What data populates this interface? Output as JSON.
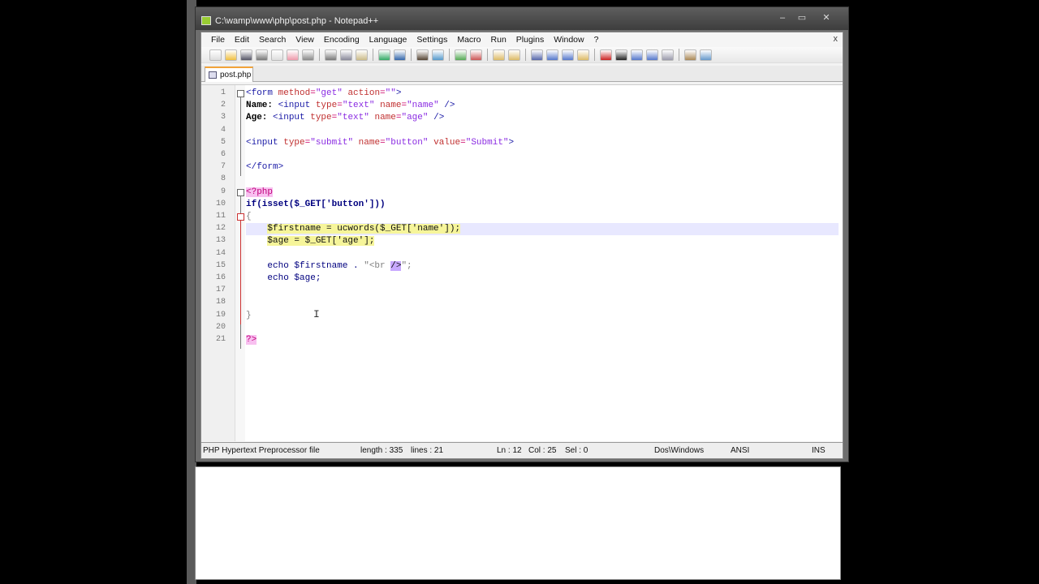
{
  "window": {
    "title": "C:\\wamp\\www\\php\\post.php - Notepad++",
    "minimize": "–",
    "maximize": "▭",
    "close": "✕"
  },
  "menu": [
    "File",
    "Edit",
    "Search",
    "View",
    "Encoding",
    "Language",
    "Settings",
    "Macro",
    "Run",
    "Plugins",
    "Window",
    "?"
  ],
  "menu_close": "x",
  "toolbar": [
    "new-file",
    "open-file",
    "save",
    "save-all",
    "close",
    "close-all",
    "print",
    "|",
    "cut",
    "copy",
    "paste",
    "|",
    "undo",
    "redo",
    "|",
    "find",
    "replace",
    "|",
    "zoom-in",
    "zoom-out",
    "|",
    "sync-v",
    "sync-h",
    "|",
    "word-wrap",
    "show-all-chars",
    "indent-guide",
    "user-lang",
    "|",
    "record-macro",
    "stop-record",
    "play-macro",
    "run-macro-multiple",
    "save-macro",
    "|",
    "launch-browser",
    "spell-check"
  ],
  "tab": {
    "label": "post.php"
  },
  "code": [
    [
      [
        "<form ",
        "tag"
      ],
      [
        "method",
        "attr"
      ],
      [
        "=",
        "op"
      ],
      [
        "\"get\" ",
        "str"
      ],
      [
        "action",
        "attr"
      ],
      [
        "=",
        "op"
      ],
      [
        "\"\"",
        "str"
      ],
      [
        ">",
        "tag"
      ]
    ],
    [
      [
        "Name: ",
        "plain"
      ],
      [
        "<input ",
        "tag"
      ],
      [
        "type",
        "attr"
      ],
      [
        "=",
        "op"
      ],
      [
        "\"text\" ",
        "str"
      ],
      [
        "name",
        "attr"
      ],
      [
        "=",
        "op"
      ],
      [
        "\"name\" ",
        "str"
      ],
      [
        "/>",
        "tag"
      ]
    ],
    [
      [
        "Age: ",
        "plain"
      ],
      [
        "<input ",
        "tag"
      ],
      [
        "type",
        "attr"
      ],
      [
        "=",
        "op"
      ],
      [
        "\"text\" ",
        "str"
      ],
      [
        "name",
        "attr"
      ],
      [
        "=",
        "op"
      ],
      [
        "\"age\" ",
        "str"
      ],
      [
        "/>",
        "tag"
      ]
    ],
    [],
    [
      [
        "<input ",
        "tag"
      ],
      [
        "type",
        "attr"
      ],
      [
        "=",
        "op"
      ],
      [
        "\"submit\" ",
        "str"
      ],
      [
        "name",
        "attr"
      ],
      [
        "=",
        "op"
      ],
      [
        "\"button\" ",
        "str"
      ],
      [
        "value",
        "attr"
      ],
      [
        "=",
        "op"
      ],
      [
        "\"Submit\"",
        "str"
      ],
      [
        ">",
        "tag"
      ]
    ],
    [],
    [
      [
        "</form>",
        "tag"
      ]
    ],
    [],
    [
      [
        "<?php",
        "php"
      ]
    ],
    [
      [
        "if(isset($_GET['button']))",
        "kw"
      ]
    ],
    [
      [
        "{",
        "phpstr"
      ]
    ],
    [
      [
        "    ",
        "plain"
      ],
      [
        "$firstname = ucwords($_GET['name']);",
        "hl"
      ]
    ],
    [
      [
        "    ",
        "plain"
      ],
      [
        "$age = $_GET['age'];",
        "hl"
      ]
    ],
    [],
    [
      [
        "    ",
        "plain"
      ],
      [
        "echo $firstname . ",
        "var"
      ],
      [
        "\"<br ",
        "phpstr"
      ],
      [
        "/>",
        "sel"
      ],
      [
        "\";",
        "phpstr"
      ]
    ],
    [
      [
        "    ",
        "plain"
      ],
      [
        "echo $age;",
        "var"
      ]
    ],
    [],
    [],
    [
      [
        "}",
        "phpstr"
      ]
    ],
    [],
    [
      [
        "?>",
        "php"
      ]
    ]
  ],
  "status": {
    "file_type": "PHP Hypertext Preprocessor file",
    "length": "length : 335",
    "lines": "lines : 21",
    "ln": "Ln : 12",
    "col": "Col : 25",
    "sel": "Sel : 0",
    "eol": "Dos\\Windows",
    "encoding": "ANSI",
    "mode": "INS"
  }
}
